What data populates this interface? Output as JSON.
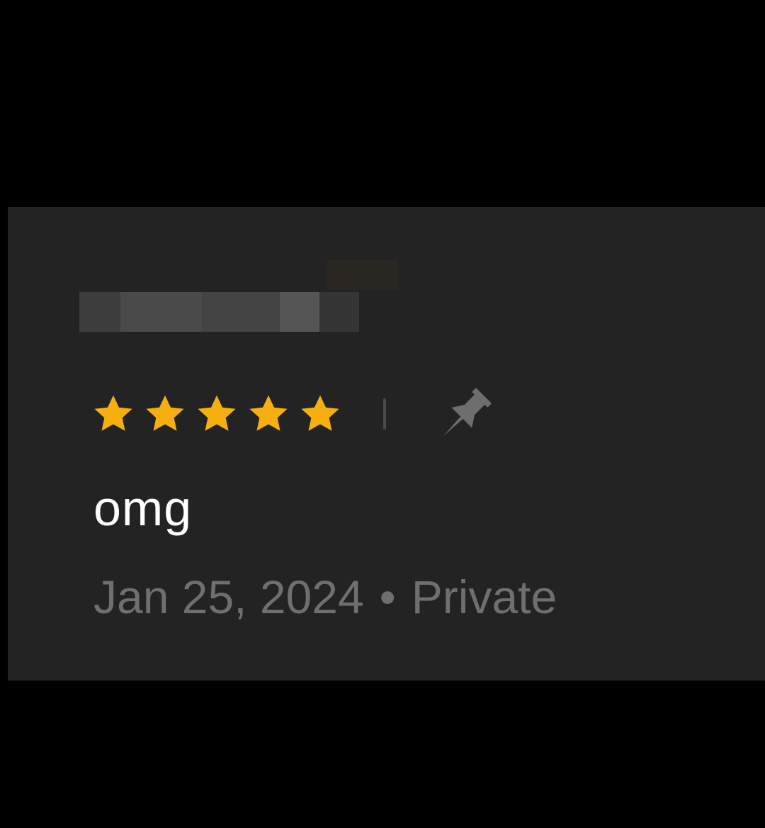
{
  "review": {
    "rating": 5,
    "max_rating": 5,
    "text": "omg",
    "date": "Jan 25, 2024",
    "separator": "•",
    "visibility": "Private"
  },
  "colors": {
    "star": "#F5B010",
    "pin": "#6e6e6e",
    "card_background": "#232323",
    "page_background": "#000000"
  },
  "icons": {
    "rating": "star-icon",
    "pin": "pin-icon"
  }
}
